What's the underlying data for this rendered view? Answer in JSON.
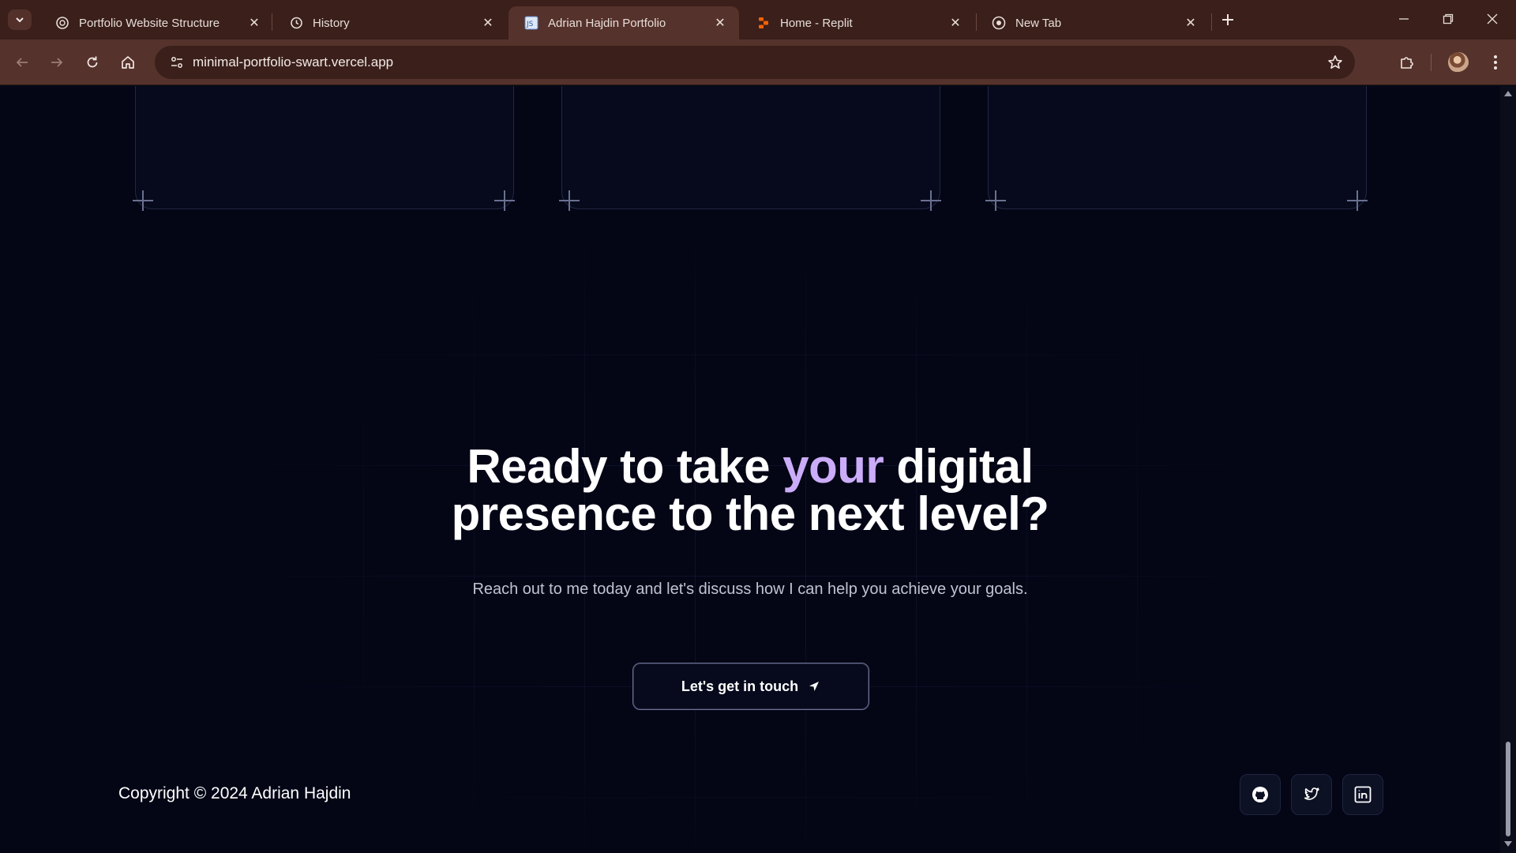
{
  "browser": {
    "tabs": [
      {
        "title": "Portfolio Website Structure",
        "icon": "openai-icon",
        "active": false
      },
      {
        "title": "History",
        "icon": "history-icon",
        "active": false
      },
      {
        "title": "Adrian Hajdin Portfolio",
        "icon": "site-favicon",
        "active": true
      },
      {
        "title": "Home - Replit",
        "icon": "replit-icon",
        "active": false
      },
      {
        "title": "New Tab",
        "icon": "chrome-icon",
        "active": false
      }
    ],
    "url": "minimal-portfolio-swart.vercel.app"
  },
  "page": {
    "headline_before": "Ready to take ",
    "headline_highlight": "your",
    "headline_after_line1": " digital",
    "headline_line2": "presence to the next level?",
    "subtitle": "Reach out to me today and let's discuss how I can help you achieve your goals.",
    "cta_label": "Let's get in touch",
    "copyright": "Copyright © 2024 Adrian Hajdin",
    "socials": [
      "github-icon",
      "twitter-icon",
      "linkedin-icon"
    ]
  },
  "colors": {
    "background": "#040616",
    "accent": "#cbacf9",
    "chrome": "#55322b"
  }
}
